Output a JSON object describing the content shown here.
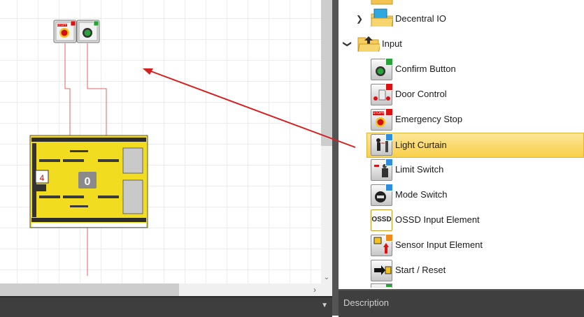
{
  "tree": {
    "items": [
      {
        "label": "Decentral IO",
        "type": "folder",
        "expanded": false
      },
      {
        "label": "Input",
        "type": "folder",
        "expanded": true
      },
      {
        "label": "Confirm Button"
      },
      {
        "label": "Door Control"
      },
      {
        "label": "Emergency Stop",
        "icon_text": "STOPP"
      },
      {
        "label": "Light Curtain",
        "selected": true
      },
      {
        "label": "Limit Switch"
      },
      {
        "label": "Mode Switch"
      },
      {
        "label": "OSSD Input Element",
        "icon_text": "OSSD"
      },
      {
        "label": "Sensor Input Element"
      },
      {
        "label": "Start / Reset"
      }
    ]
  },
  "canvas": {
    "stopp_text": "STOPP",
    "module_display": "0",
    "module_left_display": "4"
  },
  "description": {
    "label": "Description"
  },
  "colors": {
    "selection": "#f8cf48",
    "wire": "#e0645e",
    "arrow": "#d61f1f",
    "module": "#f2dc1f"
  }
}
